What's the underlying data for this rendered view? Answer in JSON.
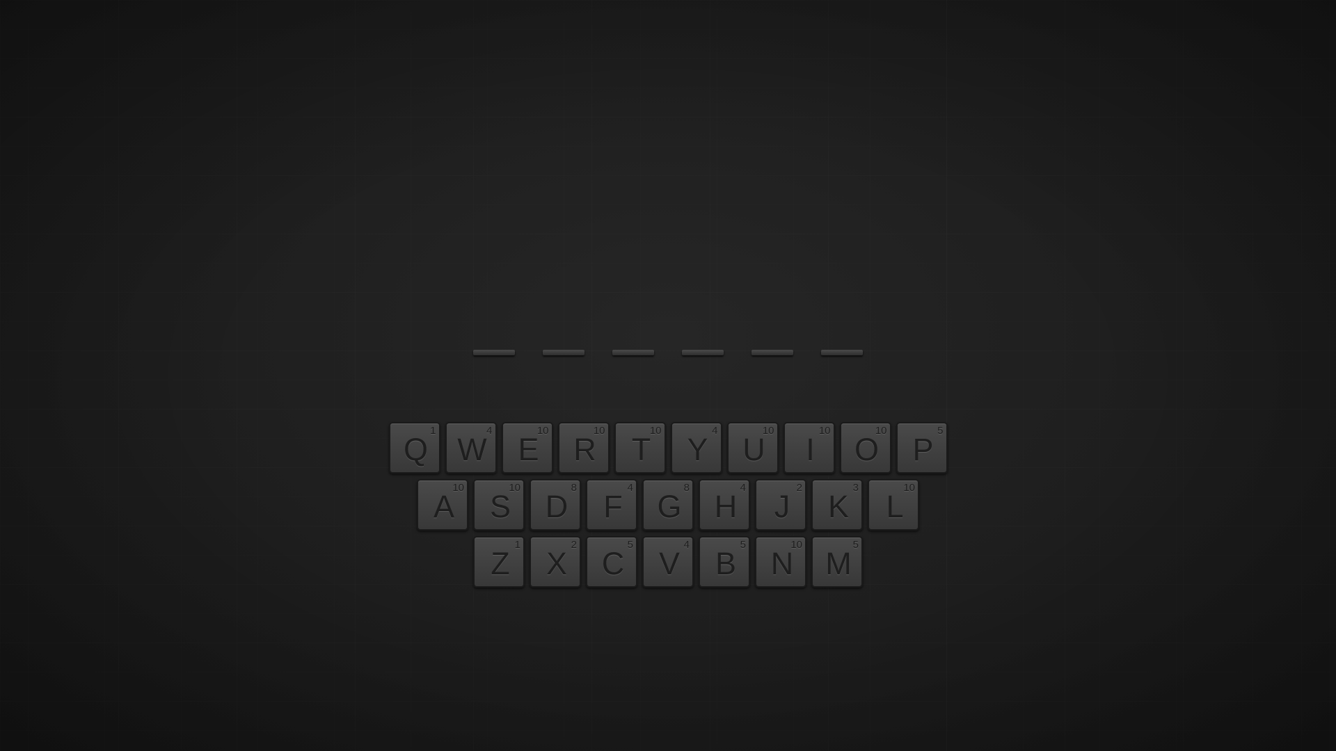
{
  "word_slots": [
    "",
    "",
    "",
    "",
    "",
    ""
  ],
  "keyboard": {
    "rows": [
      [
        {
          "letter": "Q",
          "points": "1"
        },
        {
          "letter": "W",
          "points": "4"
        },
        {
          "letter": "E",
          "points": "10"
        },
        {
          "letter": "R",
          "points": "10"
        },
        {
          "letter": "T",
          "points": "10"
        },
        {
          "letter": "Y",
          "points": "4"
        },
        {
          "letter": "U",
          "points": "10"
        },
        {
          "letter": "I",
          "points": "10"
        },
        {
          "letter": "O",
          "points": "10"
        },
        {
          "letter": "P",
          "points": "5"
        }
      ],
      [
        {
          "letter": "A",
          "points": "10"
        },
        {
          "letter": "S",
          "points": "10"
        },
        {
          "letter": "D",
          "points": "8"
        },
        {
          "letter": "F",
          "points": "4"
        },
        {
          "letter": "G",
          "points": "8"
        },
        {
          "letter": "H",
          "points": "4"
        },
        {
          "letter": "J",
          "points": "2"
        },
        {
          "letter": "K",
          "points": "3"
        },
        {
          "letter": "L",
          "points": "10"
        }
      ],
      [
        {
          "letter": "Z",
          "points": "1"
        },
        {
          "letter": "X",
          "points": "2"
        },
        {
          "letter": "C",
          "points": "5"
        },
        {
          "letter": "V",
          "points": "4"
        },
        {
          "letter": "B",
          "points": "5"
        },
        {
          "letter": "N",
          "points": "10"
        },
        {
          "letter": "M",
          "points": "5"
        }
      ]
    ]
  },
  "colors": {
    "background": "#1f1f1f",
    "tile": "#434343",
    "tile_text": "#1e1e1e",
    "slot": "#3c3c3c"
  }
}
